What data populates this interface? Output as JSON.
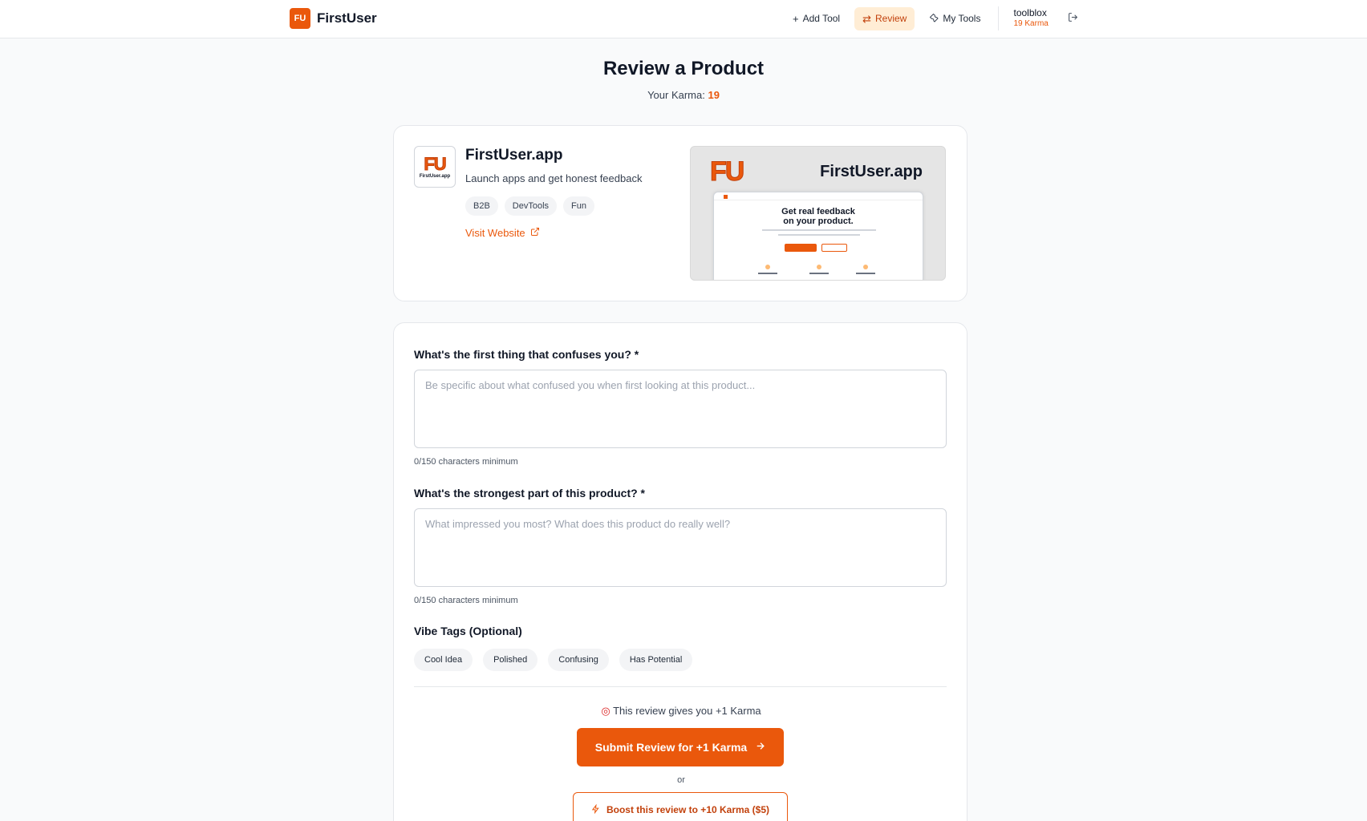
{
  "header": {
    "logo_badge": "FU",
    "logo_text": "FirstUser",
    "nav": {
      "add_tool": "Add Tool",
      "review": "Review",
      "my_tools": "My Tools"
    },
    "user": {
      "name": "toolblox",
      "karma": "19 Karma"
    }
  },
  "page": {
    "title": "Review a Product",
    "karma_label": "Your Karma:",
    "karma_value": "19"
  },
  "product": {
    "logo_text": "FU",
    "logo_caption": "FirstUser.app",
    "name": "FirstUser.app",
    "description": "Launch apps and get honest feedback",
    "tags": [
      "B2B",
      "DevTools",
      "Fun"
    ],
    "visit_label": "Visit Website",
    "preview": {
      "logo": "FU",
      "name": "FirstUser.app",
      "headline_1": "Get real feedback",
      "headline_2": "on your product."
    }
  },
  "form": {
    "q1": {
      "label": "What's the first thing that confuses you? *",
      "placeholder": "Be specific about what confused you when first looking at this product...",
      "count": "0/150 characters minimum"
    },
    "q2": {
      "label": "What's the strongest part of this product? *",
      "placeholder": "What impressed you most? What does this product do really well?",
      "count": "0/150 characters minimum"
    },
    "vibe_label": "Vibe Tags (Optional)",
    "vibe_tags": [
      "Cool Idea",
      "Polished",
      "Confusing",
      "Has Potential"
    ],
    "gives_text": "This review gives you +1 Karma",
    "submit_label": "Submit Review for +1 Karma",
    "or_text": "or",
    "boost_label": "Boost this review to +10 Karma ($5)"
  },
  "colors": {
    "accent": "#ea580c",
    "accent_light": "#ffedd5"
  }
}
